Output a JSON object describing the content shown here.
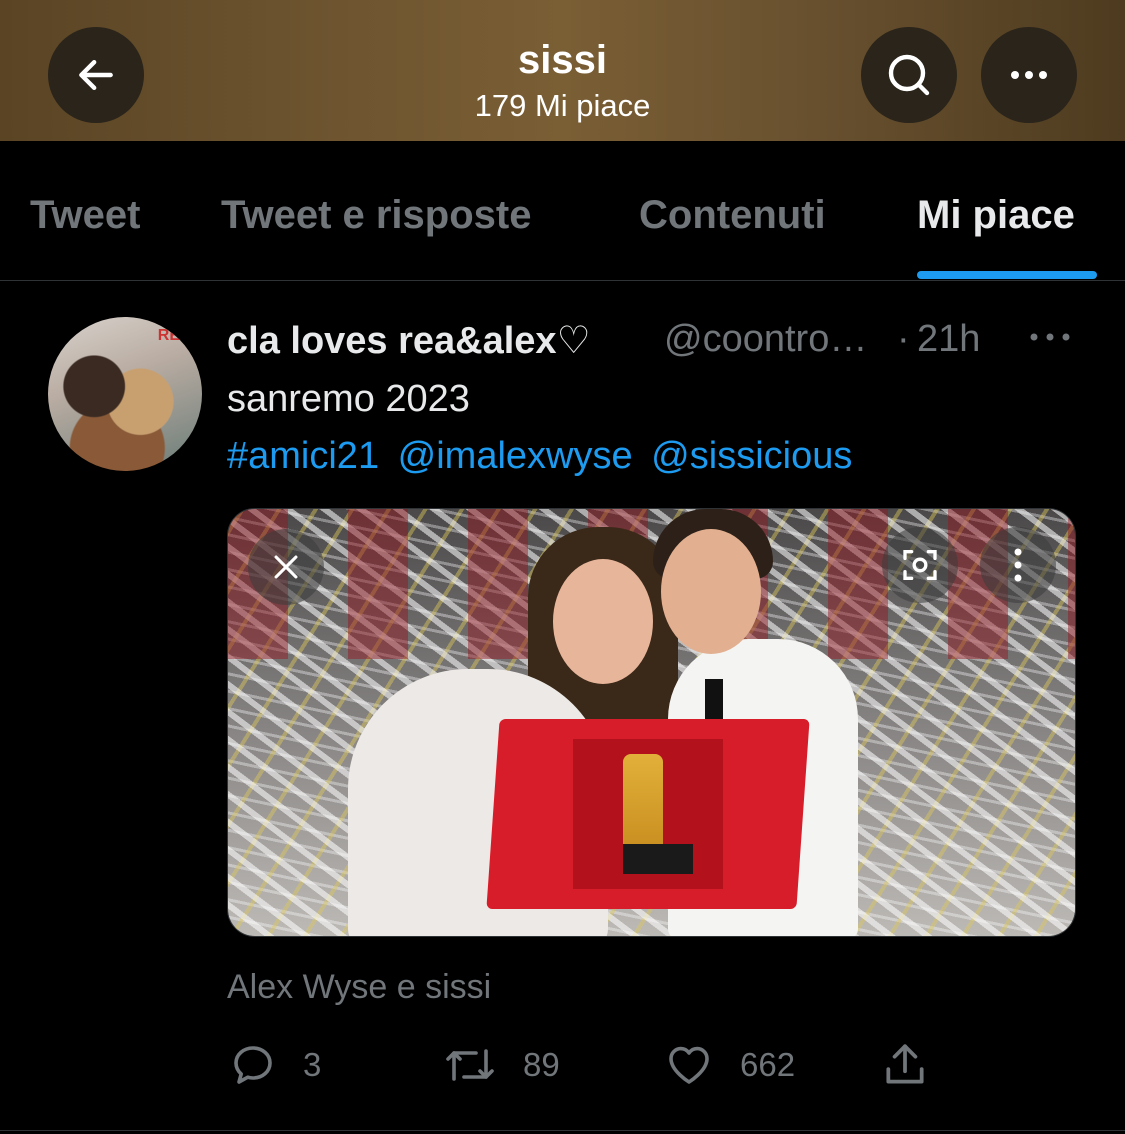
{
  "header": {
    "title": "sissi",
    "subtitle": "179 Mi piace",
    "back_icon": "arrow-left-icon",
    "search_icon": "search-icon",
    "more_icon": "more-horizontal-icon"
  },
  "tabs": [
    {
      "label": "Tweet",
      "active": false
    },
    {
      "label": "Tweet e risposte",
      "active": false
    },
    {
      "label": "Contenuti",
      "active": false
    },
    {
      "label": "Mi piace",
      "active": true
    }
  ],
  "tweet": {
    "author_name": "cla loves rea&alex♡",
    "handle": "@coontro…",
    "separator": "·",
    "time": "21h",
    "text": "sanremo 2023",
    "hashtags": [
      "#amici21",
      "@imalexwyse",
      "@sissicious"
    ],
    "avatar_tag": "RE",
    "caption": "Alex Wyse e sissi",
    "stats": {
      "replies": "3",
      "retweets": "89",
      "likes": "662"
    }
  },
  "colors": {
    "accent": "#1d9bf0",
    "muted": "#71767b",
    "background": "#000000"
  }
}
